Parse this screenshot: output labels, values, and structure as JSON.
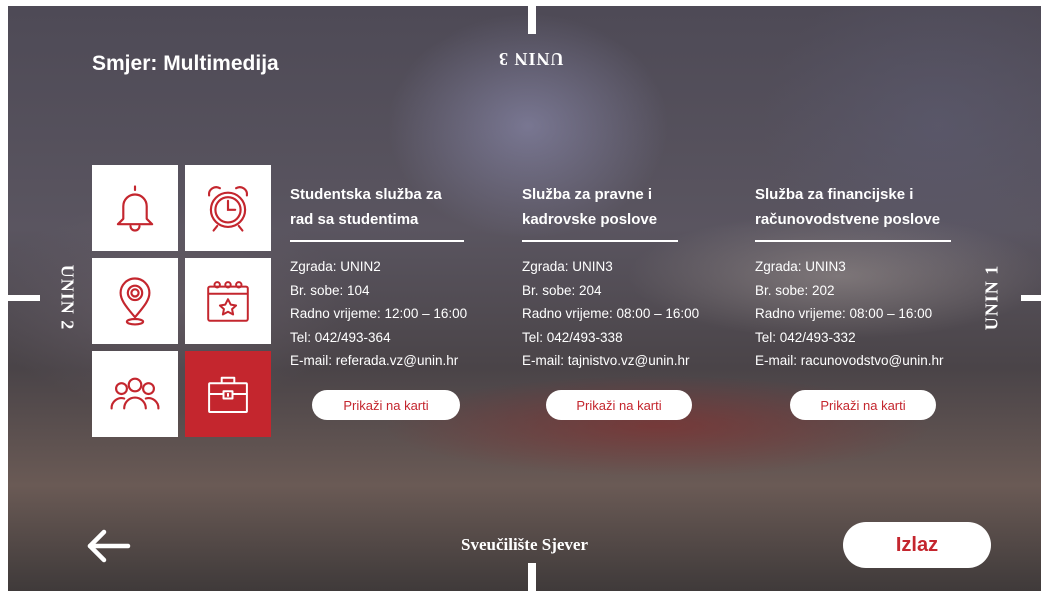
{
  "header": {
    "title": "Smjer: Multimedija"
  },
  "edges": {
    "top": "UNIN 3",
    "left": "UNIN 2",
    "right": "UNIN 1"
  },
  "tiles": [
    {
      "icon": "bell-icon",
      "active": false
    },
    {
      "icon": "alarm-clock-icon",
      "active": false
    },
    {
      "icon": "location-pin-icon",
      "active": false
    },
    {
      "icon": "calendar-star-icon",
      "active": false
    },
    {
      "icon": "people-icon",
      "active": false
    },
    {
      "icon": "briefcase-icon",
      "active": true
    }
  ],
  "offices": [
    {
      "title_line1": "Studentska služba za",
      "title_line2": "rad sa studentima",
      "building": "Zgrada: UNIN2",
      "room": "Br. sobe: 104",
      "hours": "Radno vrijeme: 12:00 – 16:00",
      "phone": "Tel: 042/493-364",
      "email": "E-mail: referada.vz@unin.hr",
      "map_button": "Prikaži na karti"
    },
    {
      "title_line1": "Služba za pravne i",
      "title_line2": "kadrovske poslove",
      "building": "Zgrada: UNIN3",
      "room": "Br. sobe: 204",
      "hours": "Radno vrijeme: 08:00 – 16:00",
      "phone": "Tel: 042/493-338",
      "email": "E-mail: tajnistvo.vz@unin.hr",
      "map_button": "Prikaži na karti"
    },
    {
      "title_line1": "Služba za financijske i",
      "title_line2": "računovodstvene poslove",
      "building": "Zgrada: UNIN3",
      "room": "Br. sobe: 202",
      "hours": "Radno vrijeme: 08:00 – 16:00",
      "phone": "Tel: 042/493-332",
      "email": "E-mail: racunovodstvo@unin.hr",
      "map_button": "Prikaži na karti"
    }
  ],
  "footer": {
    "title": "Sveučilište Sjever",
    "back_icon": "arrow-left-icon",
    "exit_label": "Izlaz"
  },
  "colors": {
    "accent": "#c4262e",
    "text": "#ffffff"
  }
}
